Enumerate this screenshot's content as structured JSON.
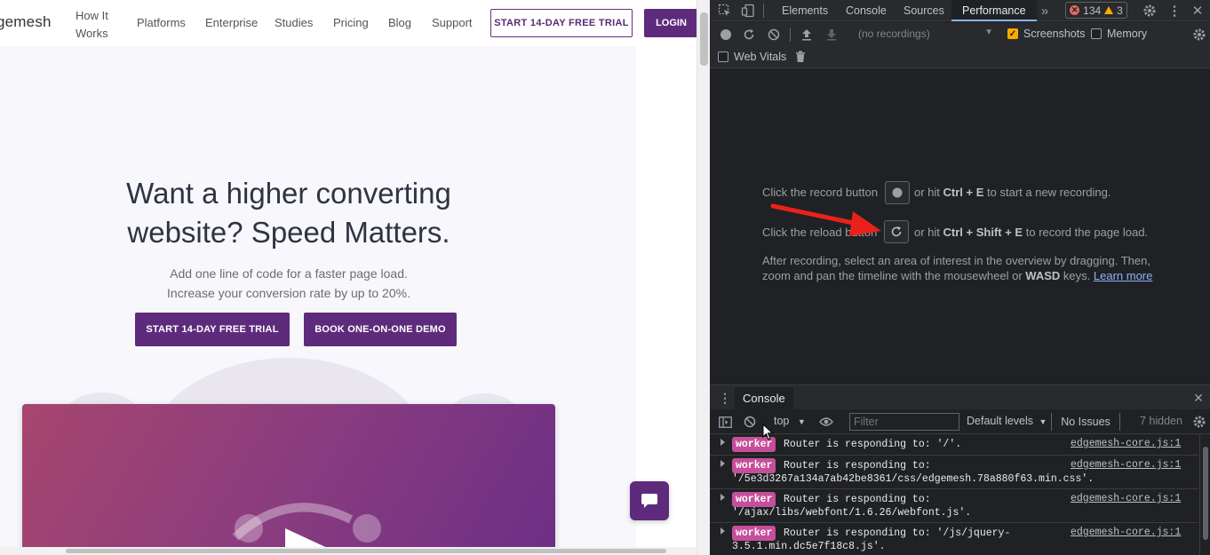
{
  "site": {
    "logo_partial": "gemesh",
    "nav": {
      "how": "How It Works",
      "platforms": "Platforms",
      "enterprise": "Enterprise",
      "studies": "Studies",
      "pricing": "Pricing",
      "blog": "Blog",
      "support": "Support"
    },
    "trial_button": "START 14-DAY FREE TRIAL",
    "login_button": "LOGIN",
    "hero": {
      "title_line1": "Want a higher converting",
      "title_line2": "website? Speed Matters.",
      "sub_line1": "Add one line of code for a faster page load.",
      "sub_line2": "Increase your conversion rate by up to 20%.",
      "trial_cta": "START 14-DAY FREE TRIAL",
      "demo_cta": "BOOK ONE-ON-ONE DEMO"
    },
    "brand_color": "#5e2b7c"
  },
  "devtools": {
    "tabs": [
      "Elements",
      "Console",
      "Sources",
      "Performance"
    ],
    "active_tab": "Performance",
    "error_count": "134",
    "warning_count": "3",
    "recordings_placeholder": "(no recordings)",
    "screenshots_label": "Screenshots",
    "memory_label": "Memory",
    "web_vitals_label": "Web Vitals",
    "landing": {
      "record_pre": "Click the record button",
      "record_mid": "or hit",
      "record_keys": "Ctrl + E",
      "record_post": "to start a new recording.",
      "reload_pre": "Click the reload button",
      "reload_mid": "or hit",
      "reload_keys": "Ctrl + Shift + E",
      "reload_post": "to record the page load.",
      "after_line1": "After recording, select an area of interest in the overview by dragging. Then,",
      "after_line2_pre": "zoom and pan the timeline with the mousewheel or",
      "after_line2_keys": "WASD",
      "after_line2_post": "keys.",
      "learn_more": "Learn more"
    },
    "drawer_tab": "Console",
    "console": {
      "context": "top",
      "filter_placeholder": "Filter",
      "levels": "Default levels",
      "issues": "No Issues",
      "hidden": "7 hidden",
      "logs": [
        {
          "tag": "worker",
          "msg": "Router is responding to: '/'.",
          "msg2": "",
          "src": "edgemesh-core.js:1"
        },
        {
          "tag": "worker",
          "msg": "Router is responding to:",
          "msg2": "'/5e3d3267a134a7ab42be8361/css/edgemesh.78a880f63.min.css'.",
          "src": "edgemesh-core.js:1"
        },
        {
          "tag": "worker",
          "msg": "Router is responding to:",
          "msg2": "'/ajax/libs/webfont/1.6.26/webfont.js'.",
          "src": "edgemesh-core.js:1"
        },
        {
          "tag": "worker",
          "msg": "Router is responding to: '/js/jquery-",
          "msg2": "3.5.1.min.dc5e7f18c8.js'.",
          "src": "edgemesh-core.js:1"
        }
      ]
    },
    "accent_color": "#8ab4f8"
  }
}
